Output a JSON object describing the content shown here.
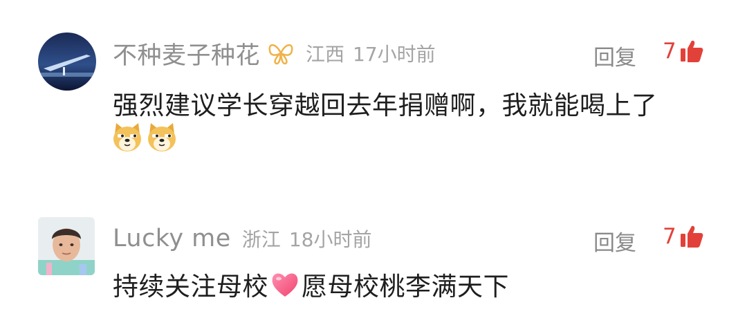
{
  "comments": [
    {
      "username": "不种麦子种花",
      "location": "江西",
      "time": "17小时前",
      "reply_label": "回复",
      "likes": "7",
      "text": "强烈建议学长穿越回去年捐赠啊，我就能喝上了",
      "emojis": [
        "doge-emoji",
        "doge-emoji"
      ]
    },
    {
      "username": "Lucky me",
      "location": "浙江",
      "time": "18小时前",
      "reply_label": "回复",
      "likes": "7",
      "text_before": "持续关注母校",
      "text_after": "愿母校桃李满天下"
    }
  ],
  "colors": {
    "username": "#8f8f8f",
    "meta": "#a4a4a4",
    "like_accent": "#e2413a",
    "text": "#1e1e1e"
  }
}
